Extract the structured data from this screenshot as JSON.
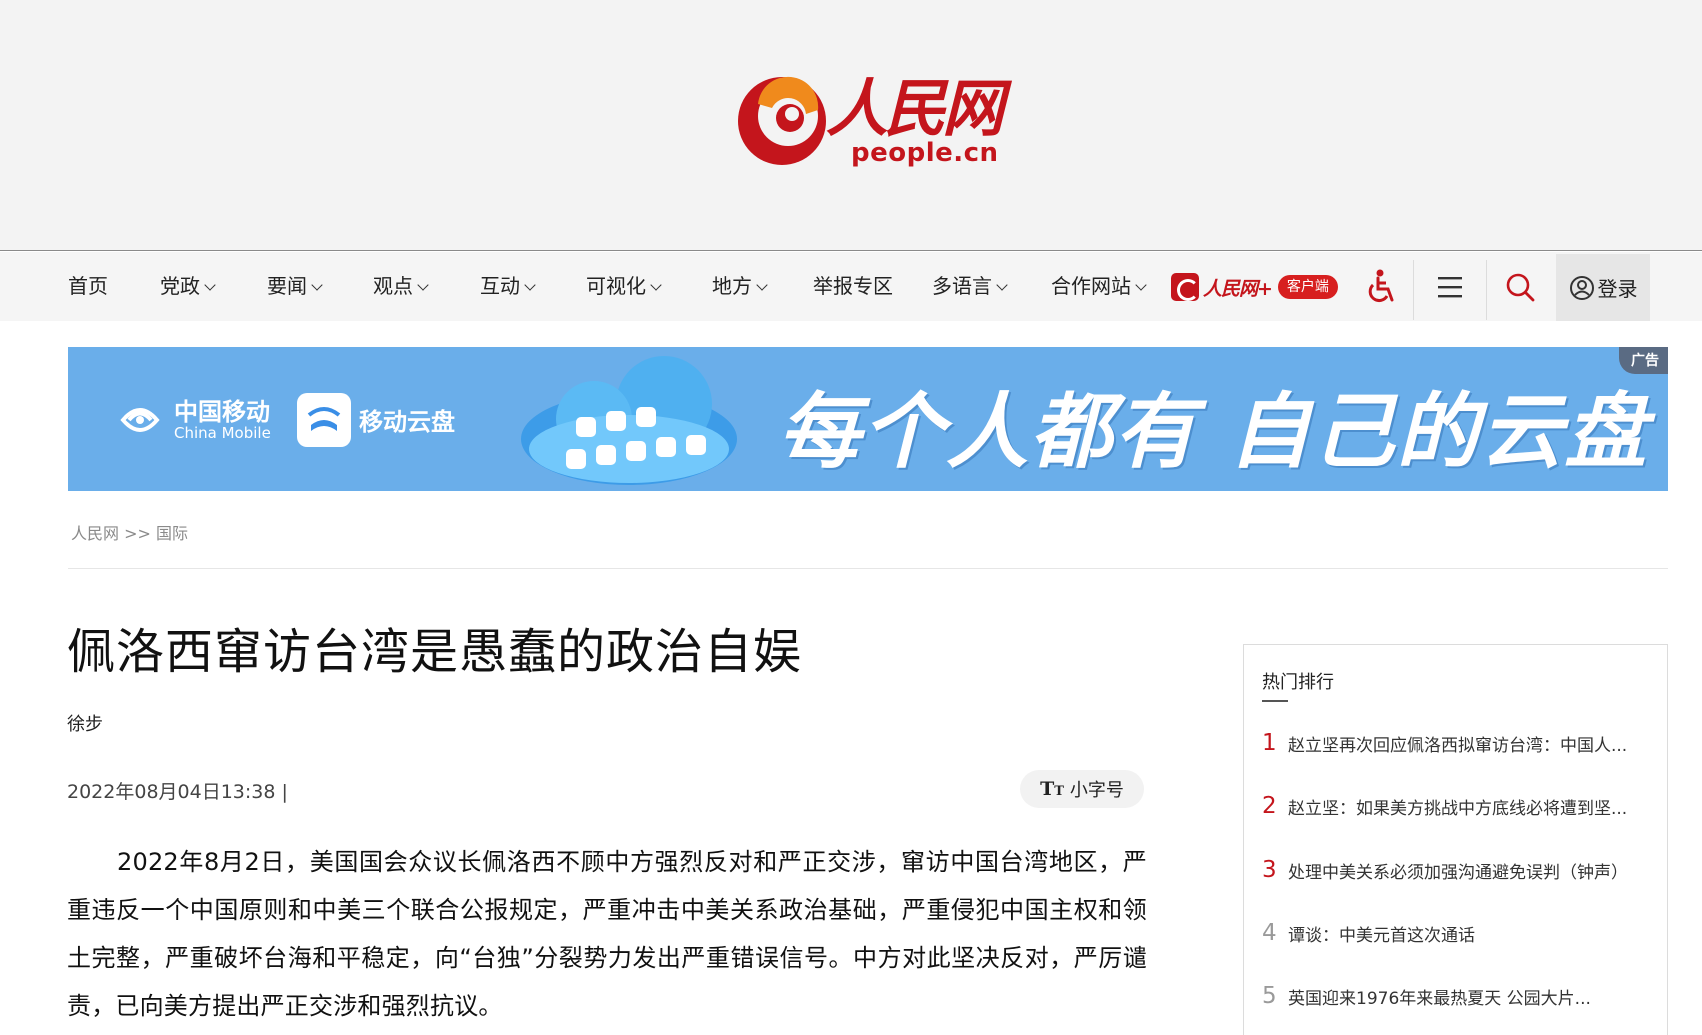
{
  "site": {
    "logo_cn": "人民网",
    "logo_url": "people.cn",
    "brand_color": "#c4151c"
  },
  "nav": {
    "items": [
      {
        "label": "首页",
        "dropdown": false
      },
      {
        "label": "党政",
        "dropdown": true
      },
      {
        "label": "要闻",
        "dropdown": true
      },
      {
        "label": "观点",
        "dropdown": true
      },
      {
        "label": "互动",
        "dropdown": true
      },
      {
        "label": "可视化",
        "dropdown": true
      },
      {
        "label": "地方",
        "dropdown": true
      },
      {
        "label": "举报专区",
        "dropdown": false
      },
      {
        "label": "多语言",
        "dropdown": true
      },
      {
        "label": "合作网站",
        "dropdown": true
      }
    ],
    "app_name": "人民网+",
    "app_pill": "客户端",
    "accessibility_icon": "wheelchair-icon",
    "menu_icon": "hamburger-menu-icon",
    "search_icon": "search-icon",
    "login_label": "登录",
    "login_icon": "user-circle-icon"
  },
  "ad": {
    "brand_cn": "中国移动",
    "brand_en": "China Mobile",
    "product": "移动云盘",
    "slogan": "每个人都有 自己的云盘",
    "tag": "广告",
    "bg_color": "#6aaeea"
  },
  "breadcrumb": {
    "home": "人民网",
    "separator": ">>",
    "section": "国际"
  },
  "article": {
    "title": "佩洛西窜访台湾是愚蠢的政治自娱",
    "author": "徐步",
    "datetime": "2022年08月04日13:38 |",
    "font_toggle_label": "小字号",
    "font_toggle_icon": "TT",
    "body": "2022年8月2日，美国国会众议长佩洛西不顾中方强烈反对和严正交涉，窜访中国台湾地区，严重违反一个中国原则和中美三个联合公报规定，严重冲击中美关系政治基础，严重侵犯中国主权和领土完整，严重破坏台海和平稳定，向“台独”分裂势力发出严重错误信号。中方对此坚决反对，严厉谴责，已向美方提出严正交涉和强烈抗议。"
  },
  "sidebar": {
    "title": "热门排行",
    "items": [
      {
        "rank": "1",
        "text": "赵立坚再次回应佩洛西拟窜访台湾：中国人...",
        "color": "#c4151c"
      },
      {
        "rank": "2",
        "text": "赵立坚：如果美方挑战中方底线必将遭到坚...",
        "color": "#c4151c"
      },
      {
        "rank": "3",
        "text": "处理中美关系必须加强沟通避免误判（钟声）",
        "color": "#c4151c"
      },
      {
        "rank": "4",
        "text": "谭谈：中美元首这次通话",
        "color": "#9a9a9a"
      },
      {
        "rank": "5",
        "text": "英国迎来1976年来最热夏天 公园大片...",
        "color": "#9a9a9a"
      }
    ]
  }
}
